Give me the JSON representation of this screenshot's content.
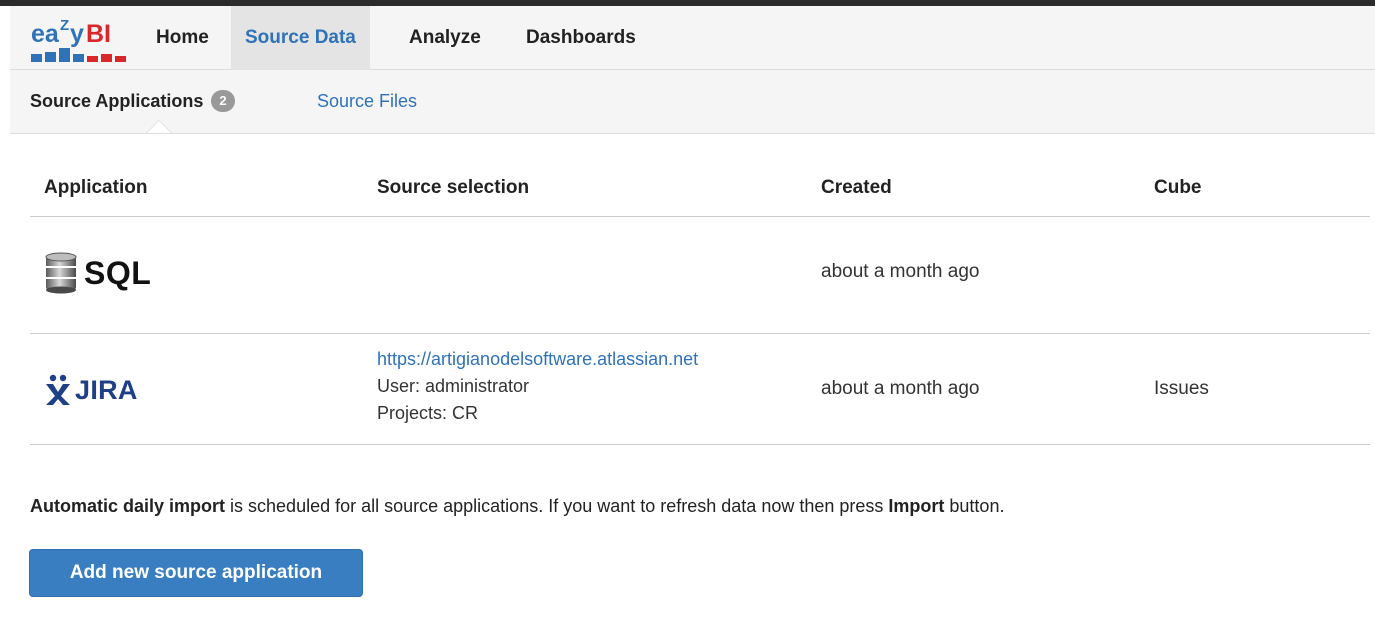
{
  "brand": {
    "logo_text_primary": "ea",
    "logo_text_super": "Z",
    "logo_text_tail": "y",
    "logo_text_bi": "BI",
    "colors": {
      "blue": "#2f72b8",
      "red": "#d9262b"
    }
  },
  "nav": {
    "items": [
      {
        "label": "Home"
      },
      {
        "label": "Source Data"
      },
      {
        "label": "Analyze"
      },
      {
        "label": "Dashboards"
      }
    ]
  },
  "subnav": {
    "source_applications_label": "Source Applications",
    "source_applications_count": "2",
    "source_files_label": "Source Files"
  },
  "table": {
    "columns": [
      "Application",
      "Source selection",
      "Created",
      "Cube"
    ],
    "rows": [
      {
        "app_icon": "database-icon",
        "app_name": "SQL",
        "source_link": "",
        "source_user": "",
        "source_projects": "",
        "created": "about a month ago",
        "cube": ""
      },
      {
        "app_icon": "jira-icon",
        "app_name": "JIRA",
        "source_link": "https://artigianodelsoftware.atlassian.net",
        "source_user": "User: administrator",
        "source_projects": "Projects: CR",
        "created": "about a month ago",
        "cube": "Issues"
      }
    ]
  },
  "notice": {
    "lead_bold": "Automatic daily import",
    "middle": " is scheduled for all source applications. If you want to refresh data now then press ",
    "import_bold": "Import",
    "tail": " button."
  },
  "actions": {
    "add_label": "Add new source application"
  },
  "colors": {
    "link": "#2f72b8",
    "primary_button": "#3a7ec2",
    "badge": "#999999",
    "jira_blue": "#1f3f86"
  }
}
